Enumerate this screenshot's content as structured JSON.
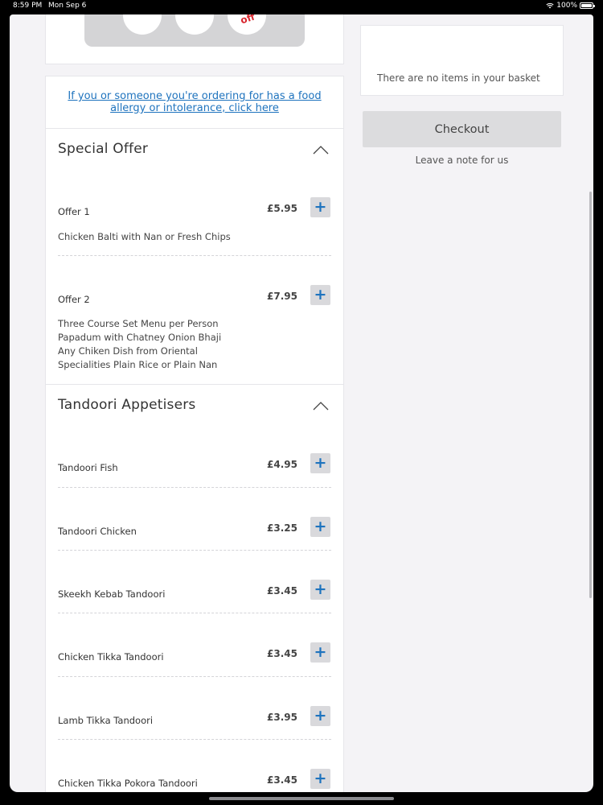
{
  "status_bar": {
    "time": "8:59 PM",
    "date": "Mon Sep 6",
    "battery": "100%"
  },
  "promo": {
    "badge_text": "off",
    "badge_color": "#d8262e"
  },
  "allergy_notice": "If you or someone you're ordering for has a food allergy or intolerance, click here",
  "sections": [
    {
      "title": "Special Offer",
      "items": [
        {
          "name": "Offer 1",
          "price": "£5.95",
          "description": "Chicken Balti with Nan or Fresh Chips"
        },
        {
          "name": "Offer 2",
          "price": "£7.95",
          "description": "Three Course Set Menu per Person\nPapadum with Chatney Onion Bhaji\nAny Chiken Dish from Oriental\nSpecialities Plain Rice or Plain Nan"
        }
      ]
    },
    {
      "title": "Tandoori Appetisers",
      "items": [
        {
          "name": "Tandoori Fish",
          "price": "£4.95"
        },
        {
          "name": "Tandoori Chicken",
          "price": "£3.25"
        },
        {
          "name": "Skeekh Kebab Tandoori",
          "price": "£3.45"
        },
        {
          "name": "Chicken Tikka Tandoori",
          "price": "£3.45"
        },
        {
          "name": "Lamb Tikka Tandoori",
          "price": "£3.95"
        },
        {
          "name": "Chicken Tikka Pokora Tandoori",
          "price": "£3.45"
        }
      ]
    }
  ],
  "add_button_label": "+",
  "basket": {
    "empty_message": "There are no items in your basket",
    "checkout_label": "Checkout",
    "note_label": "Leave a note for us"
  },
  "colors": {
    "accent": "#1e73be",
    "button_bg": "#d9d9dc",
    "page_bg": "#f4f3f6"
  }
}
